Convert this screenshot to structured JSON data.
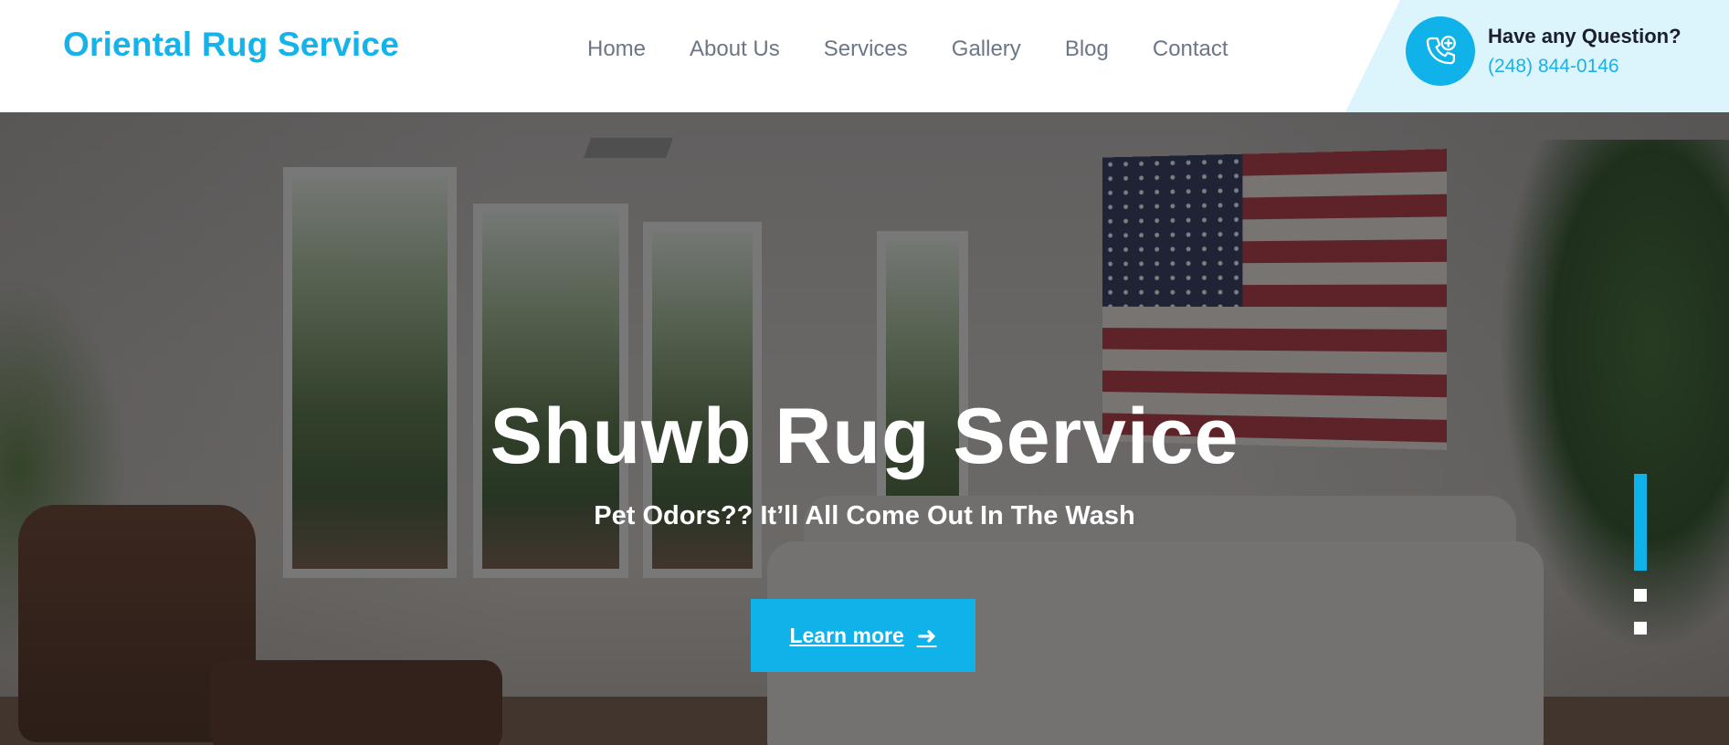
{
  "header": {
    "logo": "Oriental Rug Service",
    "nav": [
      "Home",
      "About Us",
      "Services",
      "Gallery",
      "Blog",
      "Contact"
    ],
    "contact": {
      "question": "Have any Question?",
      "phone": "(248) 844-0146",
      "icon": "phone-plus-icon"
    }
  },
  "hero": {
    "title": "Shuwb Rug Service",
    "subtitle": "Pet Odors?? It’ll All Come Out In The Wash",
    "cta_label": "Learn more",
    "cta_icon": "arrow-right-icon",
    "slides_total": 3,
    "active_slide": 1
  },
  "colors": {
    "accent": "#10b2ea",
    "nav_text": "#6b7787",
    "panel_bg": "#dcf4fc"
  }
}
